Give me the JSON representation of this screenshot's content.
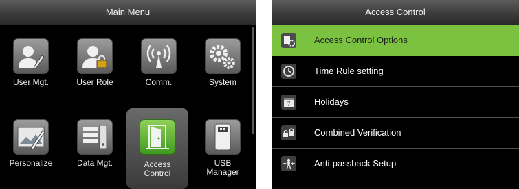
{
  "main_menu": {
    "title": "Main Menu",
    "items": [
      {
        "label": "User Mgt.",
        "icon": "user-edit-icon"
      },
      {
        "label": "User Role",
        "icon": "user-lock-icon"
      },
      {
        "label": "Comm.",
        "icon": "antenna-icon"
      },
      {
        "label": "System",
        "icon": "gears-icon"
      },
      {
        "label": "Personalize",
        "icon": "picture-edit-icon"
      },
      {
        "label": "Data Mgt.",
        "icon": "server-icon"
      },
      {
        "label": "Access\nControl",
        "icon": "door-icon",
        "selected": true
      },
      {
        "label": "USB\nManager",
        "icon": "usb-drive-icon"
      }
    ]
  },
  "access_control": {
    "title": "Access Control",
    "items": [
      {
        "label": "Access Control Options",
        "icon": "options-icon",
        "selected": true
      },
      {
        "label": "Time Rule setting",
        "icon": "clock-icon"
      },
      {
        "label": "Holidays",
        "icon": "calendar-icon"
      },
      {
        "label": "Combined Verification",
        "icon": "combined-lock-icon"
      },
      {
        "label": "Anti-passback Setup",
        "icon": "anti-passback-icon"
      }
    ]
  },
  "colors": {
    "accent_green": "#7cc241",
    "background": "#000000"
  }
}
